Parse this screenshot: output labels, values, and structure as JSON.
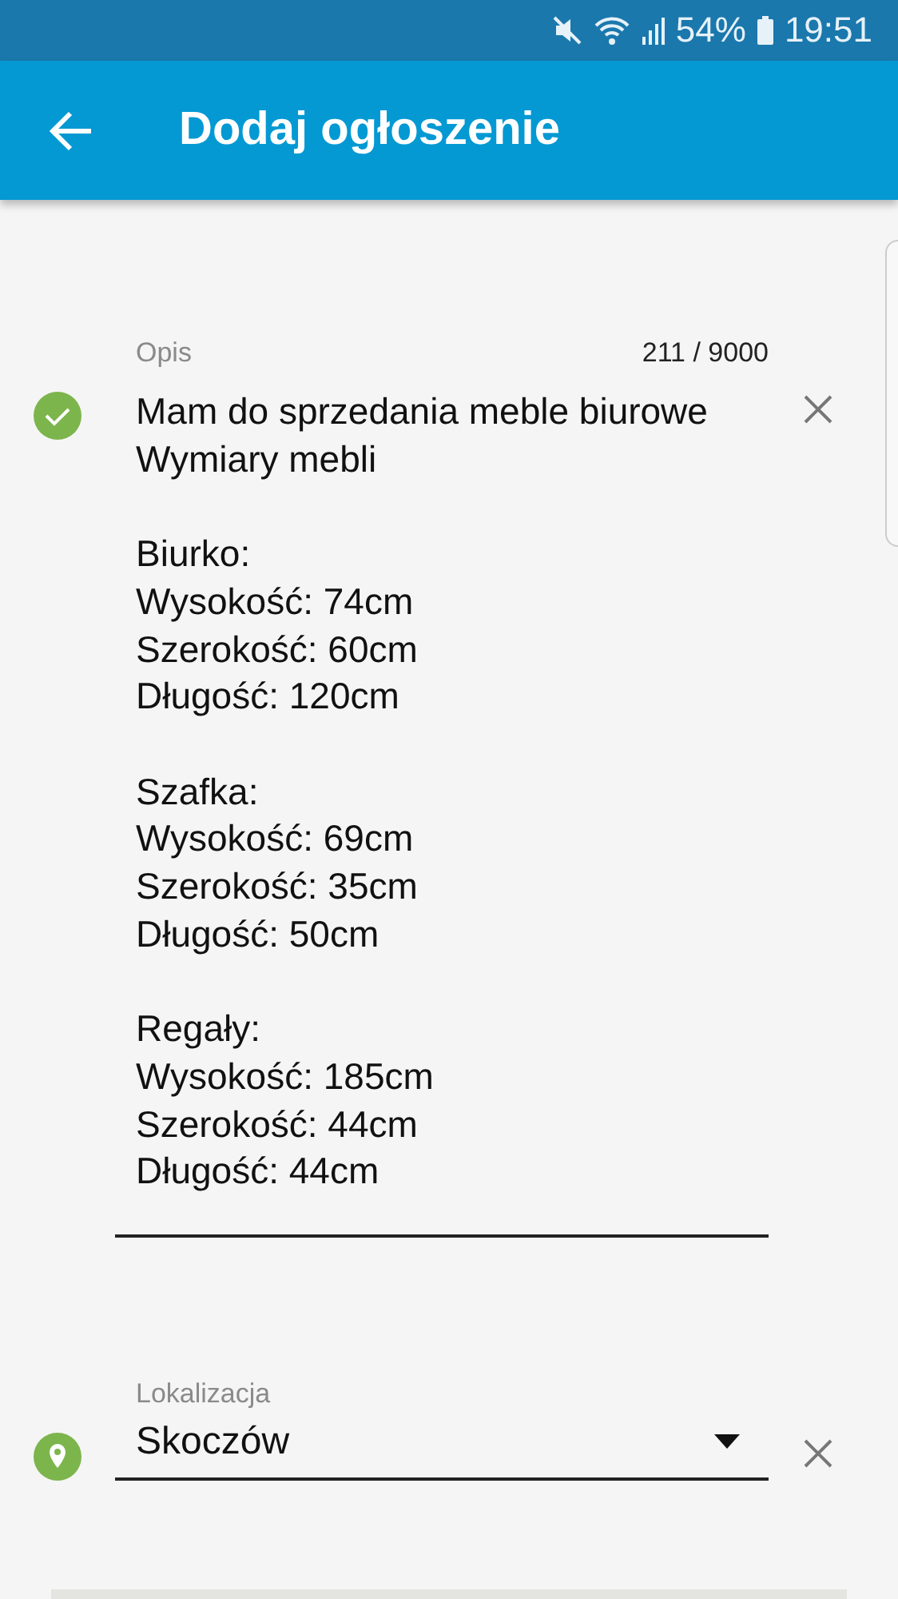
{
  "status_bar": {
    "battery": "54%",
    "time": "19:51"
  },
  "app_bar": {
    "title": "Dodaj ogłoszenie"
  },
  "description": {
    "label": "Opis",
    "counter": "211 / 9000",
    "valid": true,
    "value": "Mam do sprzedania meble biurowe\nWymiary mebli\n\nBiurko:\nWysokość: 74cm\nSzerokość: 60cm\nDługość: 120cm\n\nSzafka:\nWysokość: 69cm\nSzerokość: 35cm\nDługość: 50cm\n\nRegały:\nWysokość: 185cm\nSzerokość: 44cm\nDługość: 44cm"
  },
  "location": {
    "label": "Lokalizacja",
    "value": "Skoczów"
  }
}
